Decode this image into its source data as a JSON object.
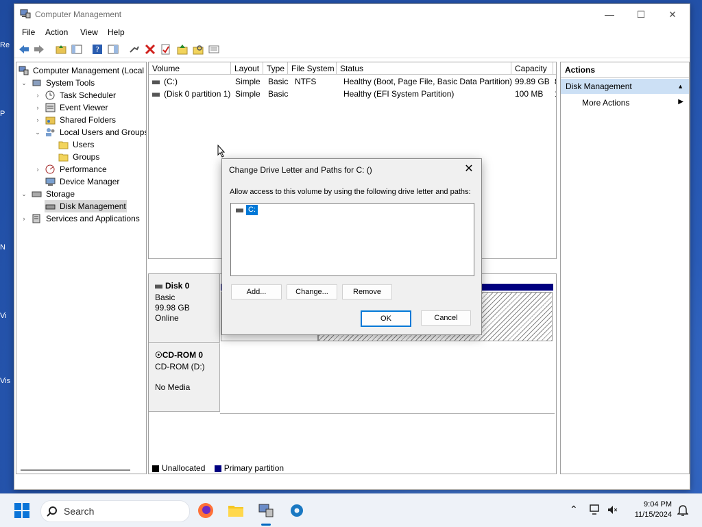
{
  "window": {
    "title": "Computer Management"
  },
  "menu": [
    "File",
    "Action",
    "View",
    "Help"
  ],
  "tree": {
    "root": "Computer Management (Local",
    "items": [
      {
        "label": "System Tools",
        "icon": "tools-icon"
      },
      {
        "label": "Task Scheduler",
        "icon": "clock-icon"
      },
      {
        "label": "Event Viewer",
        "icon": "event-viewer-icon"
      },
      {
        "label": "Shared Folders",
        "icon": "shared-folder-icon"
      },
      {
        "label": "Local Users and Groups",
        "icon": "users-icon"
      },
      {
        "label": "Users",
        "icon": "folder-icon"
      },
      {
        "label": "Groups",
        "icon": "folder-icon"
      },
      {
        "label": "Performance",
        "icon": "performance-icon"
      },
      {
        "label": "Device Manager",
        "icon": "device-manager-icon"
      },
      {
        "label": "Storage",
        "icon": "storage-icon"
      },
      {
        "label": "Disk Management",
        "icon": "disk-management-icon"
      },
      {
        "label": "Services and Applications",
        "icon": "services-icon"
      }
    ]
  },
  "volumes": {
    "columns": [
      "Volume",
      "Layout",
      "Type",
      "File System",
      "Status",
      "Capacity",
      "I"
    ],
    "rows": [
      [
        "(C:)",
        "Simple",
        "Basic",
        "NTFS",
        "Healthy (Boot, Page File, Basic Data Partition)",
        "99.89 GB",
        "8"
      ],
      [
        "(Disk 0 partition 1)",
        "Simple",
        "Basic",
        "",
        "Healthy (EFI System Partition)",
        "100 MB",
        "1"
      ]
    ]
  },
  "disks": [
    {
      "name": "Disk 0",
      "type": "Basic",
      "size": "99.98 GB",
      "state": "Online"
    },
    {
      "name": "CD-ROM 0",
      "type": "CD-ROM (D:)",
      "state": "No Media"
    }
  ],
  "legend": [
    "Unallocated",
    "Primary partition"
  ],
  "actions": {
    "header": "Actions",
    "selected": "Disk Management",
    "more": "More Actions"
  },
  "dialog": {
    "title": "Change Drive Letter and Paths for C: ()",
    "label": "Allow access to this volume by using the following drive letter and paths:",
    "entry": "C:",
    "add": "Add...",
    "change": "Change...",
    "remove": "Remove",
    "ok": "OK",
    "cancel": "Cancel"
  },
  "taskbar": {
    "search_placeholder": "Search",
    "time": "9:04 PM",
    "date": "11/15/2024"
  },
  "colors": {
    "accent": "#0078d7",
    "primary_partition": "#000080",
    "selection": "#cce0f5"
  }
}
